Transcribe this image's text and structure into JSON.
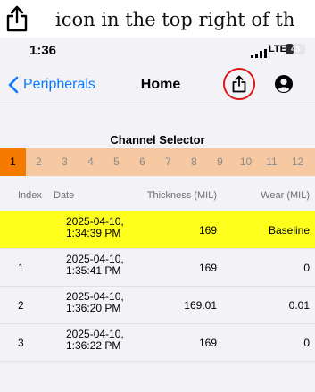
{
  "caption": {
    "text": "icon in the top right of th"
  },
  "status_bar": {
    "time": "1:36",
    "network": "LTE",
    "battery": "43",
    "battery_level": 0.43
  },
  "nav": {
    "back_label": "Peripherals",
    "title": "Home"
  },
  "channel_selector": {
    "title": "Channel Selector",
    "channels": [
      "1",
      "2",
      "3",
      "4",
      "5",
      "6",
      "7",
      "8",
      "9",
      "10",
      "11",
      "12"
    ],
    "active_index": 0
  },
  "table": {
    "headers": {
      "index": "Index",
      "date": "Date",
      "thickness": "Thickness (MIL)",
      "wear": "Wear (MIL)"
    },
    "rows": [
      {
        "index": "",
        "date_line1": "2025-04-10,",
        "date_line2": "1:34:39 PM",
        "thickness": "169",
        "wear": "Baseline"
      },
      {
        "index": "1",
        "date_line1": "2025-04-10,",
        "date_line2": "1:35:41 PM",
        "thickness": "169",
        "wear": "0"
      },
      {
        "index": "2",
        "date_line1": "2025-04-10,",
        "date_line2": "1:36:20 PM",
        "thickness": "169.01",
        "wear": "0.01"
      },
      {
        "index": "3",
        "date_line1": "2025-04-10,",
        "date_line2": "1:36:22 PM",
        "thickness": "169",
        "wear": "0"
      }
    ]
  },
  "colors": {
    "accent": "#0a7aff",
    "channel_active": "#f57b00",
    "channel_inactive": "#f6c9a3",
    "baseline_highlight": "#ffff1e",
    "annotation_circle": "#e01616"
  }
}
